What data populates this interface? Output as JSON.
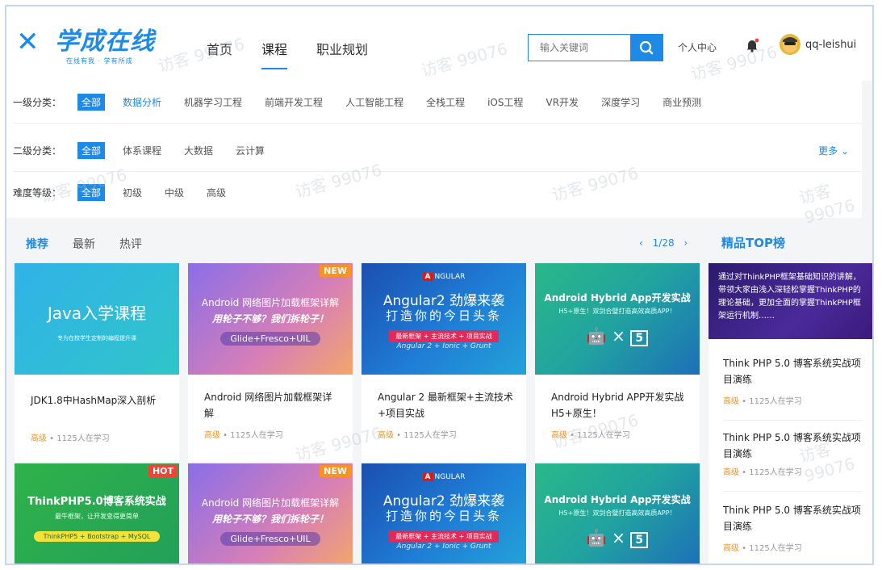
{
  "header": {
    "logo_title": "学成在线",
    "logo_sub": "在线有我 · 学有所成",
    "nav": [
      "首页",
      "课程",
      "职业规划"
    ],
    "search_placeholder": "输入关键词",
    "user_center": "个人中心",
    "username": "qq-leishui",
    "accent": "#1e8ae6"
  },
  "filters": {
    "level1": {
      "label": "一级分类：",
      "all": "全部",
      "items": [
        "数据分析",
        "机器学习工程",
        "前端开发工程",
        "人工智能工程",
        "全栈工程",
        "iOS工程",
        "VR开发",
        "深度学习",
        "商业预测"
      ]
    },
    "level2": {
      "label": "二级分类：",
      "all": "全部",
      "items": [
        "体系课程",
        "大数据",
        "云计算"
      ],
      "more": "更多"
    },
    "difficulty": {
      "label": "难度等级：",
      "all": "全部",
      "items": [
        "初级",
        "中级",
        "高级"
      ]
    }
  },
  "tabs": [
    "推荐",
    "最新",
    "热评"
  ],
  "pager": "1/28",
  "top_title": "精品TOP榜",
  "cards": [
    {
      "img_title": "Java入学课程",
      "img_sub": "专为在校学生定制的编程提升课",
      "badge": "",
      "title": "JDK1.8中HashMap深入剖析",
      "level": "高级",
      "learners": "1125人在学习"
    },
    {
      "img_title": "Android 网络图片加载框架详解",
      "img_sub": "用轮子不够？我们拆轮子！",
      "img_pill": "Glide+Fresco+UIL",
      "badge": "NEW",
      "title": "Android 网络图片加载框架详解",
      "level": "高级",
      "learners": "1125人在学习"
    },
    {
      "img_brand": "NGULAR",
      "img_title": "Angular2 劲爆来袭",
      "img_title2": "打造你的今日头条",
      "img_pill": "最新框架 + 主流技术 + 项目实战",
      "img_sub": "Angular 2 + Ionic + Grunt",
      "badge": "",
      "title": "Angular 2 最新框架+主流技术+项目实战",
      "level": "高级",
      "learners": "1125人在学习"
    },
    {
      "img_title": "Android Hybrid App开发实战",
      "img_sub": "H5+原生！双剑合璧打造高效高质APP！",
      "badge": "",
      "title": "Android Hybrid APP开发实战 H5+原生！",
      "level": "高级",
      "learners": "1125人在学习"
    },
    {
      "img_title": "ThinkPHP5.0博客系统实战",
      "img_sub": "最牛框架，让开发变得更简单",
      "img_pill": "ThinkPHP5 + Bootstrap + MySQL",
      "badge": "HOT"
    },
    {
      "img_title": "Android 网络图片加载框架详解",
      "img_sub": "用轮子不够？我们拆轮子！",
      "img_pill": "Glide+Fresco+UIL",
      "badge": "NEW"
    },
    {
      "img_brand": "NGULAR",
      "img_title": "Angular2 劲爆来袭",
      "img_title2": "打造你的今日头条",
      "img_pill": "最新框架 + 主流技术 + 项目实战",
      "img_sub": "Angular 2 + Ionic + Grunt",
      "badge": ""
    },
    {
      "img_title": "Android Hybrid App开发实战",
      "img_sub": "H5+原生！双剑合璧打造高效高质APP！",
      "badge": ""
    }
  ],
  "top": {
    "banner": "通过对ThinkPHP框架基础知识的讲解，带领大家由浅入深轻松掌握ThinkPHP的理论基础，更加全面的掌握ThinkPHP框架运行机制……",
    "items": [
      {
        "title": "Think PHP 5.0 博客系统实战项目演练",
        "level": "高级",
        "learners": "1125人在学习"
      },
      {
        "title": "Think PHP 5.0 博客系统实战项目演练",
        "level": "高级",
        "learners": "1125人在学习"
      },
      {
        "title": "Think PHP 5.0 博客系统实战项目演练",
        "level": "高级",
        "learners": "1125人在学习"
      }
    ]
  },
  "watermark": "访客 99076"
}
